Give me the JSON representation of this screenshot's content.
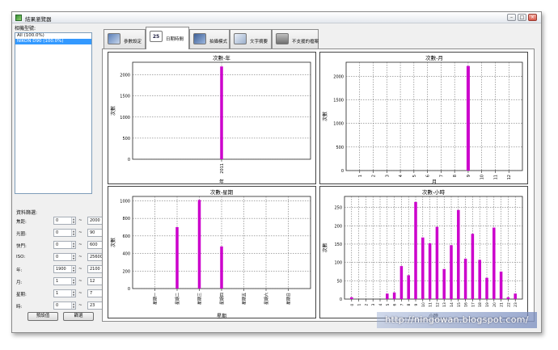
{
  "window": {
    "title": "結果瀏覽器"
  },
  "left_panel": {
    "group_label": "相機型號:",
    "groups": [
      {
        "label": "All (100.0%)",
        "selected": false
      },
      {
        "label": "NIKON D90 (100.0%)",
        "selected": true
      }
    ],
    "filter_label": "資料篩選:",
    "filters": [
      {
        "label": "焦距:",
        "min": "0",
        "max": "2000"
      },
      {
        "label": "光圈:",
        "min": "0",
        "max": "90"
      },
      {
        "label": "快門:",
        "min": "0",
        "max": "600"
      },
      {
        "label": "ISO:",
        "min": "0",
        "max": "25600"
      },
      {
        "label": "年:",
        "min": "1900",
        "max": "2100"
      },
      {
        "label": "月:",
        "min": "1",
        "max": "12"
      },
      {
        "label": "星期:",
        "min": "1",
        "max": "7"
      },
      {
        "label": "時:",
        "min": "0",
        "max": "23"
      }
    ],
    "tilde": "~",
    "default_button": "預設值",
    "apply_button": "篩選"
  },
  "tabs": [
    {
      "id": "params",
      "label": "參數設定",
      "icon": "camera-settings-icon"
    },
    {
      "id": "datetime",
      "label": "日期時間",
      "icon": "calendar-icon",
      "icon_text": "25",
      "active": true
    },
    {
      "id": "shooting",
      "label": "拍攝模式",
      "icon": "camera-mode-icon"
    },
    {
      "id": "text",
      "label": "文字摘要",
      "icon": "text-summary-icon"
    },
    {
      "id": "unsupported",
      "label": "不支援的檔案",
      "icon": "trash-icon"
    }
  ],
  "bar_color": "#cc00cc",
  "watermark": "http://ningowan.blogspot.com/",
  "chart_data": [
    {
      "id": "year",
      "type": "bar",
      "title": "次數-年",
      "xlabel": "年",
      "ylabel": "次數",
      "categories": [
        "2011"
      ],
      "values": [
        2200
      ],
      "yticks": [
        0,
        500,
        1000,
        1500,
        2000
      ],
      "ylim": [
        0,
        2300
      ],
      "grid": true
    },
    {
      "id": "month",
      "type": "bar",
      "title": "次數-月",
      "xlabel": "月",
      "ylabel": "次數",
      "categories": [
        "1",
        "2",
        "3",
        "4",
        "5",
        "6",
        "7",
        "8",
        "9",
        "10",
        "11",
        "12"
      ],
      "values": [
        0,
        0,
        0,
        0,
        0,
        0,
        0,
        0,
        2220,
        0,
        0,
        0
      ],
      "yticks": [
        0,
        500,
        1000,
        1500,
        2000
      ],
      "ylim": [
        0,
        2300
      ],
      "grid": true
    },
    {
      "id": "week",
      "type": "bar",
      "title": "次數-星期",
      "xlabel": "星期",
      "ylabel": "次數",
      "categories": [
        "星期一",
        "星期二",
        "星期三",
        "星期四",
        "星期五",
        "星期六",
        "星期日"
      ],
      "values": [
        0,
        700,
        1010,
        480,
        0,
        0,
        0
      ],
      "yticks": [
        0,
        200,
        400,
        600,
        800,
        1000
      ],
      "ylim": [
        0,
        1050
      ],
      "grid": true
    },
    {
      "id": "hour",
      "type": "bar",
      "title": "次數-小時",
      "xlabel": "小時",
      "ylabel": "次數",
      "categories": [
        "0",
        "1",
        "2",
        "3",
        "4",
        "5",
        "6",
        "7",
        "8",
        "9",
        "10",
        "11",
        "12",
        "13",
        "14",
        "15",
        "16",
        "17",
        "18",
        "19",
        "20",
        "21",
        "22",
        "23"
      ],
      "values": [
        5,
        0,
        0,
        0,
        0,
        15,
        18,
        90,
        65,
        265,
        168,
        152,
        197,
        82,
        147,
        243,
        110,
        178,
        107,
        58,
        195,
        75,
        5,
        15
      ],
      "yticks": [
        0,
        50,
        100,
        150,
        200,
        250
      ],
      "ylim": [
        0,
        280
      ],
      "grid": true
    }
  ]
}
